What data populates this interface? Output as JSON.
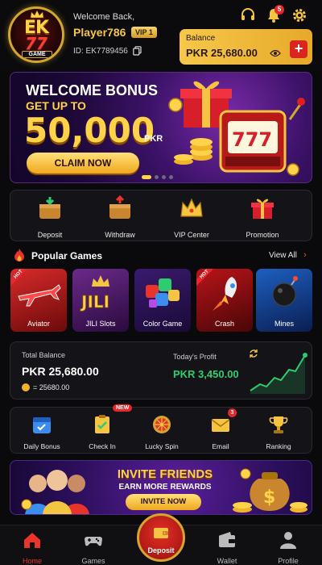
{
  "header": {
    "welcome": "Welcome Back,",
    "username": "Player786",
    "vip": "VIP 1",
    "user_id": "ID: EK7789456",
    "notification_count": "5",
    "balance_label": "Balance",
    "balance_value": "PKR 25,680.00"
  },
  "logo": {
    "brand": "EK",
    "number": "77",
    "sub": "GAME"
  },
  "banner": {
    "title": "WELCOME BONUS",
    "subtitle": "GET UP TO",
    "amount": "50,000",
    "currency": "PKR",
    "cta": "CLAIM NOW"
  },
  "quick_actions": [
    "Deposit",
    "Withdraw",
    "VIP Center",
    "Promotion"
  ],
  "popular": {
    "title": "Popular Games",
    "view_all": "View All",
    "hot_label": "HOT",
    "games": [
      "Aviator",
      "JILI Slots",
      "Color Game",
      "Crash",
      "Mines"
    ]
  },
  "stats": {
    "total_label": "Total Balance",
    "total_value": "PKR 25,680.00",
    "coins": "= 25680.00",
    "profit_label": "Today's Profit",
    "profit_value": "PKR 3,450.00"
  },
  "features": {
    "items": [
      "Daily Bonus",
      "Check In",
      "Lucky Spin",
      "Email",
      "Ranking"
    ],
    "new_badge": "NEW",
    "email_count": "3"
  },
  "invite": {
    "title": "INVITE FRIENDS",
    "subtitle": "EARN MORE REWARDS",
    "cta": "INVITE NOW"
  },
  "nav": [
    "Home",
    "Games",
    "Deposit",
    "Wallet",
    "Profile"
  ],
  "colors": {
    "accent_gold": "#f5c542",
    "accent_red": "#e8262b",
    "profit_green": "#2ecc71"
  }
}
